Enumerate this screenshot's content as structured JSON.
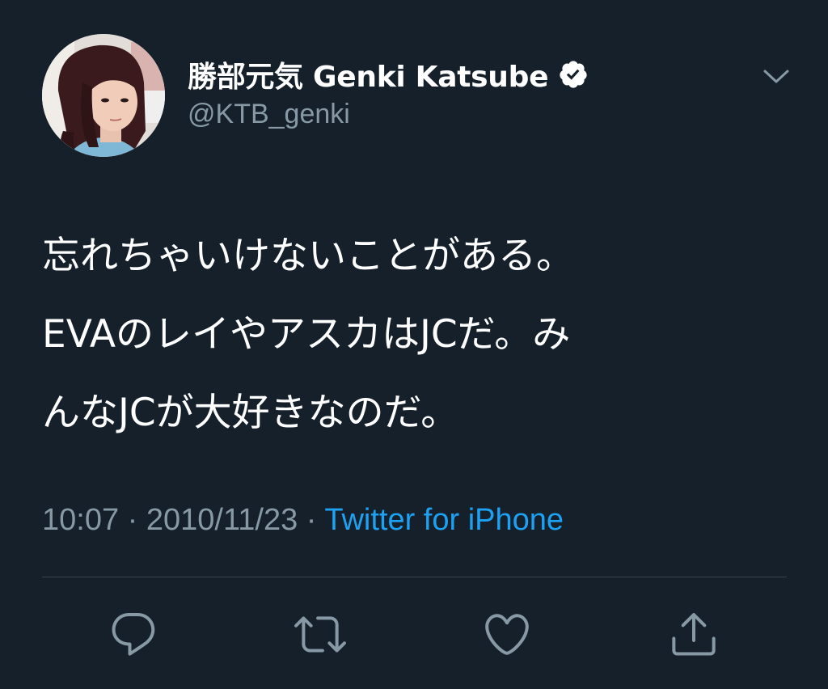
{
  "user": {
    "display_name": "勝部元気 Genki Katsube",
    "handle": "@KTB_genki",
    "verified": true,
    "avatar_icon": "profile-photo"
  },
  "tweet": {
    "lines": [
      "忘れちゃいけないことがある。",
      "EVAのレイやアスカはJCだ。み",
      "んなJCが大好きなのだ。"
    ]
  },
  "meta": {
    "time": "10:07",
    "separator": " · ",
    "date": "2010/11/23",
    "source": "Twitter for iPhone"
  },
  "actions": {
    "reply_icon": "reply-icon",
    "retweet_icon": "retweet-icon",
    "like_icon": "heart-icon",
    "share_icon": "share-icon"
  },
  "colors": {
    "background": "#15202b",
    "text": "#ffffff",
    "secondary_text": "#8899a6",
    "link": "#1da1f2",
    "divider": "#38444d"
  }
}
